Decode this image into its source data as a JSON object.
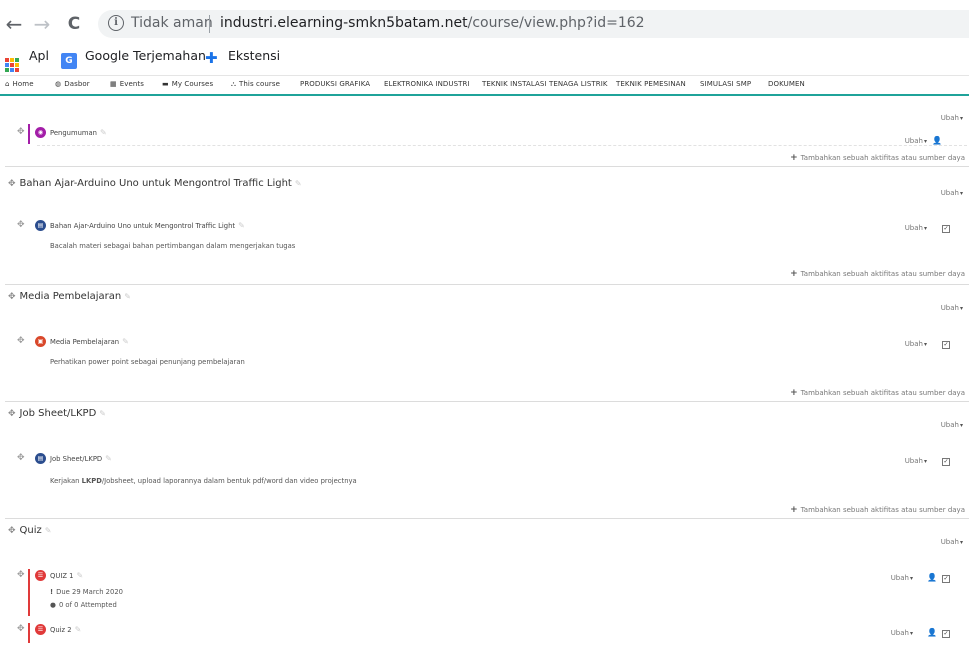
{
  "browser": {
    "back": "←",
    "forward": "→",
    "reload": "C",
    "security_warning": "Tidak aman",
    "url_host": "industri.elearning-smkn5batam.net",
    "url_path": "/course/view.php?id=162"
  },
  "bookmarks": [
    {
      "label": "Apl"
    },
    {
      "label": "Google Terjemahan"
    },
    {
      "label": "Ekstensi"
    }
  ],
  "site_nav": {
    "home": "Home",
    "dasbor": "Dasbor",
    "events": "Events",
    "my_courses": "My Courses",
    "this_course": "This course",
    "produksi_grafika": "PRODUKSI GRAFIKA",
    "elektronika_industri": "ELEKTRONIKA INDUSTRI",
    "teknik_instalasi": "TEKNIK INSTALASI TENAGA LISTRIK",
    "teknik_pemesinan": "TEKNIK PEMESINAN",
    "simulasi_smp": "SIMULASI SMP",
    "dokumen": "DOKUMEN"
  },
  "common": {
    "ubah": "Ubah",
    "add_activity": "Tambahkan sebuah aktifitas atau sumber daya"
  },
  "sections": {
    "s0": {
      "activity": {
        "name": "Pengumuman",
        "icon_color": "#a31ea8",
        "icon": "forum-icon"
      }
    },
    "s1": {
      "title": "Bahan Ajar-Arduino Uno untuk Mengontrol Traffic Light",
      "activity": {
        "name": "Bahan Ajar-Arduino Uno untuk Mengontrol Traffic Light",
        "desc": "Bacalah materi sebagai bahan pertimbangan dalam mengerjakan tugas",
        "icon_color": "#2b4d8e"
      }
    },
    "s2": {
      "title": "Media Pembelajaran",
      "activity": {
        "name": "Media Pembelajaran",
        "desc": "Perhatikan power point sebagai penunjang pembelajaran",
        "icon_color": "#d9482b"
      }
    },
    "s3": {
      "title": "Job Sheet/LKPD",
      "activity": {
        "name": "Job Sheet/LKPD",
        "desc_bold": "LKPD",
        "desc_pre": "Kerjakan ",
        "desc_post": "/Jobsheet, upload laporannya dalam bentuk pdf/word dan video projectnya",
        "icon_color": "#2b4d8e"
      }
    },
    "s4": {
      "title": "Quiz",
      "quiz1": {
        "name": "QUIZ 1",
        "due": "Due 29 March 2020",
        "attempted": "0 of 0 Attempted",
        "icon_color": "#e03a3a"
      },
      "quiz2": {
        "name": "Quiz 2",
        "icon_color": "#e03a3a"
      }
    }
  }
}
